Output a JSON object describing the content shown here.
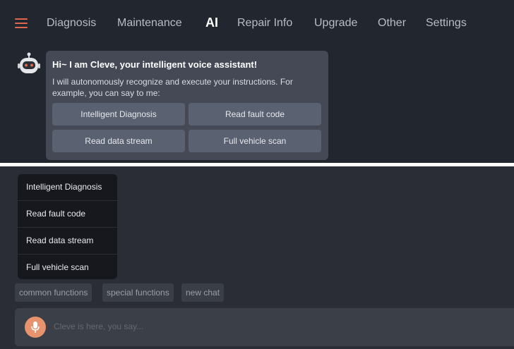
{
  "nav": {
    "menu_icon": "hamburger-menu-icon",
    "items": [
      {
        "label": "Diagnosis",
        "active": false
      },
      {
        "label": "Maintenance",
        "active": false
      },
      {
        "label": "AI",
        "active": true
      },
      {
        "label": "Repair Info",
        "active": false
      },
      {
        "label": "Upgrade",
        "active": false
      },
      {
        "label": "Other",
        "active": false
      },
      {
        "label": "Settings",
        "active": false
      }
    ]
  },
  "assistant": {
    "avatar_icon": "robot-icon",
    "title": "Hi~ I am Cleve, your intelligent voice assistant!",
    "intro": "I will autonomously recognize and execute your instructions. For example, you can say to me:",
    "quick_actions": [
      "Intelligent Diagnosis",
      "Read fault code",
      "Read data stream",
      "Full vehicle scan"
    ]
  },
  "command_menu": {
    "items": [
      "Intelligent Diagnosis",
      "Read fault code",
      "Read data stream",
      "Full vehicle scan"
    ]
  },
  "chips": [
    "common functions",
    "special functions",
    "new chat"
  ],
  "input": {
    "placeholder": "Cleve is here, you say...",
    "mic_icon": "microphone-icon"
  },
  "colors": {
    "accent": "#e0674f",
    "mic": "#e6936e",
    "bubble": "#444955",
    "button": "#5a6170"
  }
}
